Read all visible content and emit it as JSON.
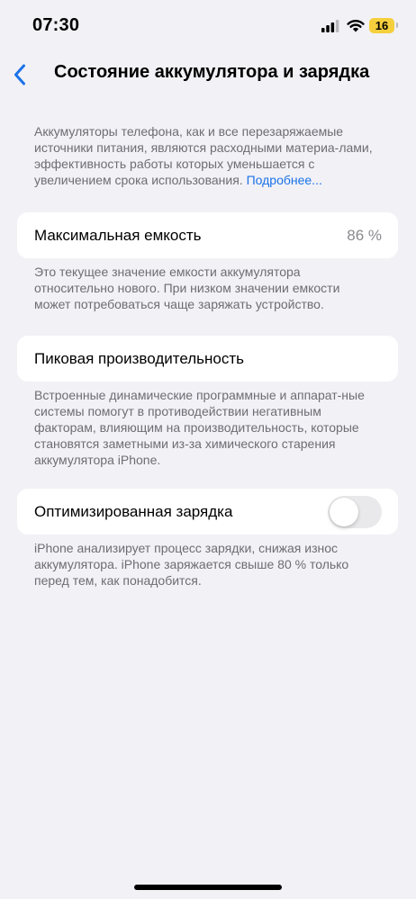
{
  "status_bar": {
    "time": "07:30",
    "battery_level": "16",
    "battery_color": "#f6cf3c",
    "icons": [
      "cellular-signal-icon",
      "wifi-icon",
      "battery-icon"
    ]
  },
  "nav": {
    "back_icon": "chevron-left-icon",
    "title": "Состояние аккумулятора и зарядка",
    "accent_color": "#1a73e8"
  },
  "intro": {
    "text": "Аккумуляторы телефона, как и все перезаряжаемые источники питания, являются расходными материа-лами, эффективность работы которых уменьшается с увеличением срока использования.",
    "link": "Подробнее..."
  },
  "max_capacity": {
    "label": "Максимальная емкость",
    "value": "86 %",
    "footnote": "Это текущее значение емкости аккумулятора относительно нового. При низком значении емкости может потребоваться чаще заряжать устройство."
  },
  "peak_performance": {
    "label": "Пиковая производительность",
    "footnote": "Встроенные динамические программные и аппарат-ные системы помогут в противодействии негативным факторам, влияющим на производительность, которые становятся заметными из-за химического старения аккумулятора iPhone."
  },
  "optimized_charging": {
    "label": "Оптимизированная зарядка",
    "enabled": false,
    "footnote": "iPhone анализирует процесс зарядки, снижая износ аккумулятора. iPhone заряжается свыше 80 % только перед тем, как понадобится."
  }
}
